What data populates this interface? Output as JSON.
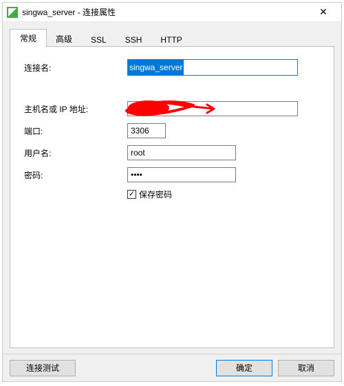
{
  "window": {
    "title": "singwa_server - 连接属性",
    "close_glyph": "✕"
  },
  "tabs": {
    "general": "常规",
    "advanced": "高级",
    "ssl": "SSL",
    "ssh": "SSH",
    "http": "HTTP"
  },
  "form": {
    "connection_name_label": "连接名:",
    "connection_name_value": "singwa_server",
    "host_label": "主机名或 IP 地址:",
    "host_value": "",
    "port_label": "端口:",
    "port_value": "3306",
    "user_label": "用户名:",
    "user_value": "root",
    "password_label": "密码:",
    "password_value": "••••",
    "save_password_label": "保存密码",
    "save_password_checked": true,
    "checkmark_glyph": "✓"
  },
  "buttons": {
    "test": "连接测试",
    "ok": "确定",
    "cancel": "取消"
  }
}
